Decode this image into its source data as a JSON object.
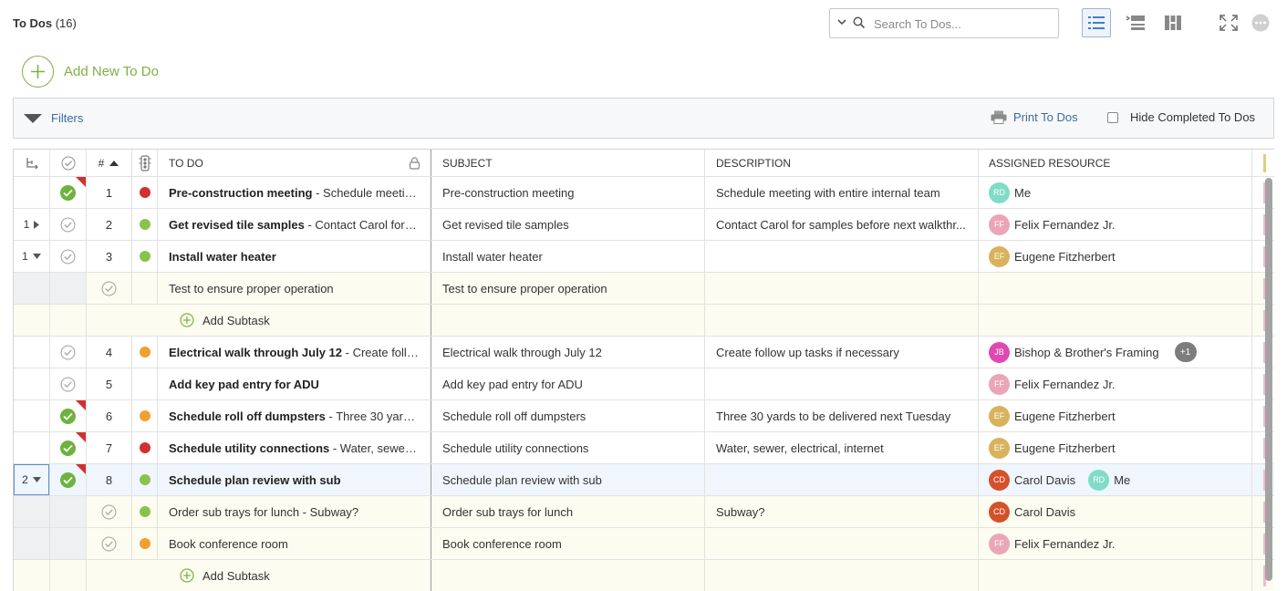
{
  "header": {
    "title": "To Dos",
    "count": "(16)",
    "search_placeholder": "Search To Dos..."
  },
  "add_new_label": "Add New To Do",
  "filters": {
    "label": "Filters",
    "print_label": "Print To Dos",
    "hide_completed_label": "Hide Completed To Dos"
  },
  "columns": {
    "num": "#",
    "todo": "TO DO",
    "subject": "SUBJECT",
    "description": "DESCRIPTION",
    "assigned": "ASSIGNED RESOURCE"
  },
  "rows": [
    {
      "expand": "",
      "num": "1",
      "title": "Pre-construction meeting",
      "detail": " - Schedule meetin...",
      "subject": "Pre-construction meeting",
      "description": "Schedule meeting with entire internal team",
      "r1_initials": "RD",
      "r1_name": "Me",
      "r1_color": "#7fdcc8"
    },
    {
      "expand": "1",
      "num": "2",
      "title": "Get revised tile samples",
      "detail": " - Contact Carol for sa...",
      "subject": "Get revised tile samples",
      "description": "Contact Carol for samples before next walkthr...",
      "r1_initials": "FF",
      "r1_name": "Felix Fernandez Jr.",
      "r1_color": "#eaa6b6"
    },
    {
      "expand": "1",
      "num": "3",
      "title": "Install water heater",
      "detail": "",
      "subject": "Install water heater",
      "description": "",
      "r1_initials": "EF",
      "r1_name": "Eugene Fitzherbert",
      "r1_color": "#d9b25c"
    },
    {
      "title": "Test to ensure proper operation",
      "subject": "Test to ensure proper operation"
    },
    {
      "add_subtask": "Add Subtask"
    },
    {
      "expand": "",
      "num": "4",
      "title": "Electrical walk through July 12",
      "detail": " -  Create follo...",
      "subject": "Electrical walk through July 12",
      "description": " Create follow up tasks if necessary",
      "r1_initials": "JB",
      "r1_name": "Bishop & Brother's Framing",
      "r1_color": "#e04ab0",
      "extra": "+1"
    },
    {
      "expand": "",
      "num": "5",
      "title": "Add key pad entry for ADU",
      "detail": "",
      "subject": "Add key pad entry for ADU",
      "description": "",
      "r1_initials": "FF",
      "r1_name": "Felix Fernandez Jr.",
      "r1_color": "#eaa6b6"
    },
    {
      "expand": "",
      "num": "6",
      "title": "Schedule roll off dumpsters",
      "detail": " - Three 30 yards ...",
      "subject": "Schedule roll off dumpsters",
      "description": "Three 30 yards to be delivered next Tuesday",
      "r1_initials": "EF",
      "r1_name": "Eugene Fitzherbert",
      "r1_color": "#d9b25c"
    },
    {
      "expand": "",
      "num": "7",
      "title": "Schedule utility connections",
      "detail": " - Water, sewer, e...",
      "subject": "Schedule utility connections",
      "description": "Water, sewer, electrical, internet",
      "r1_initials": "EF",
      "r1_name": "Eugene Fitzherbert",
      "r1_color": "#d9b25c"
    },
    {
      "expand": "2",
      "num": "8",
      "title": "Schedule plan review with sub",
      "detail": "",
      "subject": "Schedule plan review with sub",
      "description": "",
      "r1_initials": "CD",
      "r1_name": "Carol Davis",
      "r1_color": "#d4512a",
      "r2_initials": "RD",
      "r2_name": "Me",
      "r2_color": "#7fdcc8"
    },
    {
      "title": "Order sub trays for lunch",
      "detail": " - Subway?",
      "subject": "Order sub trays for lunch",
      "description": "Subway?",
      "r1_initials": "CD",
      "r1_name": "Carol Davis",
      "r1_color": "#d4512a"
    },
    {
      "title": "Book conference room",
      "subject": "Book conference room",
      "description": "",
      "r1_initials": "FF",
      "r1_name": "Felix Fernandez Jr.",
      "r1_color": "#eaa6b6"
    },
    {
      "add_subtask": "Add Subtask"
    }
  ],
  "colors": {
    "accent_green": "#7cb342",
    "link_blue": "#3d6aa0",
    "priority_red": "#d32f2f",
    "priority_green": "#8bc34a",
    "priority_orange": "#f0a030"
  }
}
